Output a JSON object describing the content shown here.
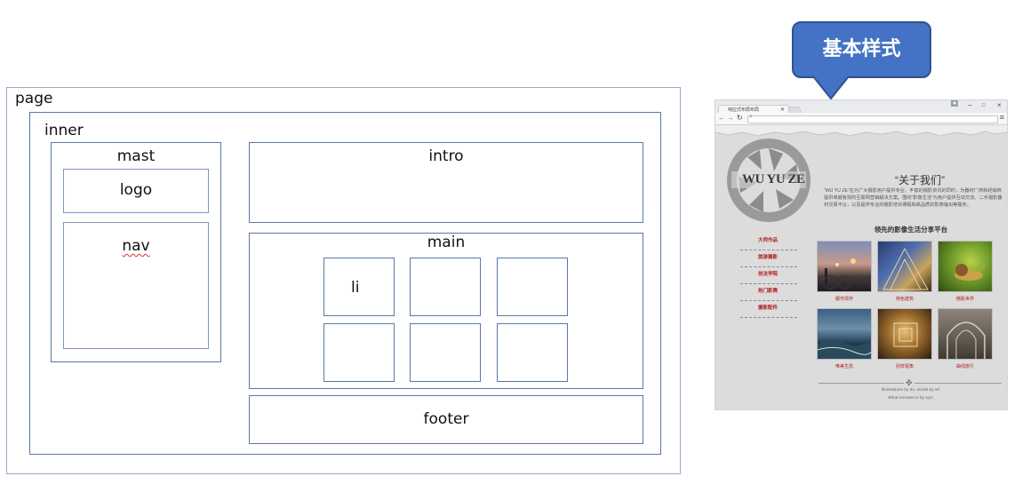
{
  "diagram": {
    "page_label": "page",
    "inner_label": "inner",
    "mast_label": "mast",
    "logo_label": "logo",
    "nav_label": "nav",
    "intro_label": "intro",
    "main_label": "main",
    "li_label": "li",
    "footer_label": "footer"
  },
  "callout": {
    "label": "基本样式",
    "color": "#4472c4"
  },
  "browser": {
    "tab_title": "响应式布局布局",
    "window_controls": [
      "–",
      "□",
      "×"
    ]
  },
  "website": {
    "logo_text": "WU YU ZE",
    "about_title": "“关于我们”",
    "about_text": "“WU YU ZE”在为广大摄影用户提供专业、丰富的摄影资讯的同时，为器材厂商和经销商提供卓越有效的互联网营销解决方案。围绕“影像生活”为用户提供互动交流、二手摄影器材交易平台，以及提供专业的摄影培训课程和高品质的影像输出等服务。",
    "platform_title": "领先的影像生活分享平台",
    "nav": [
      "大师作品",
      "旅游摄影",
      "技法学院",
      "热门影赛",
      "摄影配件"
    ],
    "gallery": [
      {
        "caption": "都市情怀",
        "icon": "city-night-photo"
      },
      {
        "caption": "特色建筑",
        "icon": "modern-building-photo"
      },
      {
        "caption": "微距世界",
        "icon": "snail-macro-photo"
      },
      {
        "caption": "唯美生态",
        "icon": "seascape-photo"
      },
      {
        "caption": "别样视角",
        "icon": "architecture-perspective-photo"
      },
      {
        "caption": "曲线旅行",
        "icon": "cathedral-arches-photo"
      }
    ],
    "footer_line1": "Illustrations by dx, words by wf.",
    "footer_line2": "What remains is by wyz.",
    "accent_color": "#b01e23"
  }
}
